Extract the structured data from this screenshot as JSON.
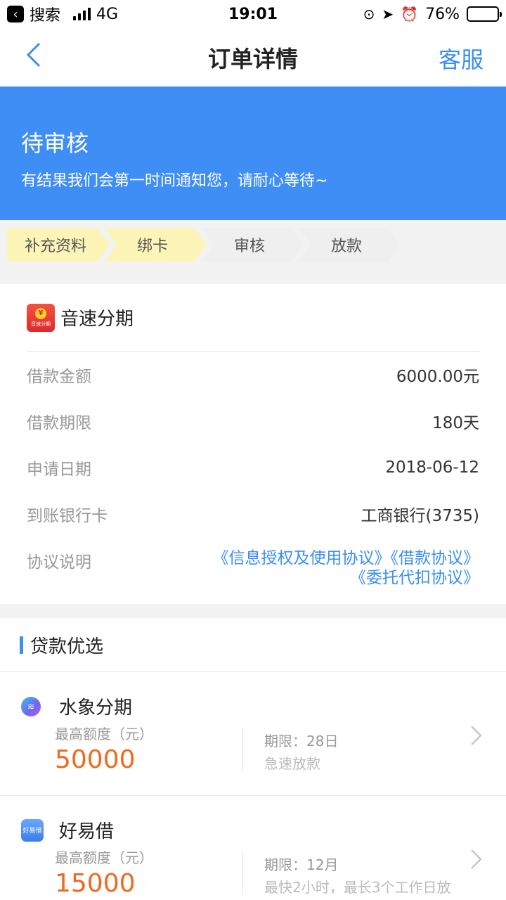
{
  "status_bar": {
    "back_app": "搜索",
    "network": "4G",
    "time": "19:01",
    "battery": "76%",
    "battery_level": 0.76
  },
  "nav": {
    "title": "订单详情",
    "service": "客服"
  },
  "banner": {
    "title": "待审核",
    "subtitle": "有结果我们会第一时间通知您，请耐心等待~"
  },
  "steps": [
    {
      "label": "补充资料",
      "active": true
    },
    {
      "label": "绑卡",
      "active": true
    },
    {
      "label": "审核",
      "active": false
    },
    {
      "label": "放款",
      "active": false
    }
  ],
  "order": {
    "brand": "音速分期",
    "logo_text": "音速分期",
    "rows": [
      {
        "key": "借款金额",
        "value": "6000.00元"
      },
      {
        "key": "借款期限",
        "value": "180天"
      },
      {
        "key": "申请日期",
        "value": "2018-06-12"
      },
      {
        "key": "到账银行卡",
        "value": "工商银行(3735)"
      }
    ],
    "agreement_label": "协议说明",
    "agreements_line1": "《信息授权及使用协议》《借款协议》",
    "agreements_line2": "《委托代扣协议》"
  },
  "recommend": {
    "title": "贷款优选",
    "items": [
      {
        "name": "水象分期",
        "quota_label": "最高额度（元）",
        "quota": "50000",
        "term": "期限：28日",
        "desc": "急速放款"
      },
      {
        "name": "好易借",
        "logo_text": "好易借",
        "quota_label": "最高额度（元）",
        "quota": "15000",
        "term": "期限：12月",
        "desc": "最快2小时，最长3个工作日放"
      }
    ]
  },
  "colors": {
    "accent": "#3c8ef0",
    "banner": "#3f8ef5",
    "step_active": "#fdf5b8",
    "step_inactive": "#efefef",
    "quota": "#f06a1e"
  }
}
